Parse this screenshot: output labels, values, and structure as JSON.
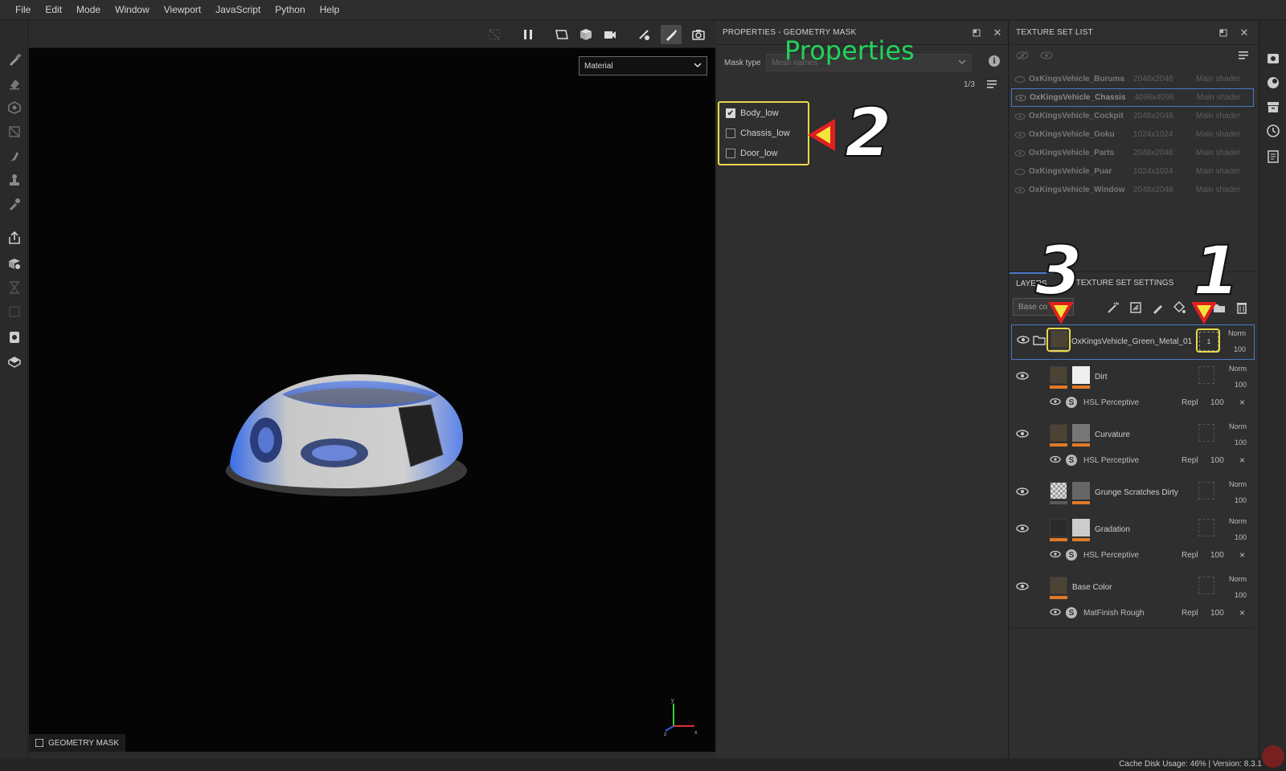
{
  "menu": [
    "File",
    "Edit",
    "Mode",
    "Window",
    "Viewport",
    "JavaScript",
    "Python",
    "Help"
  ],
  "viewport": {
    "material_select": "Material",
    "mode_label": "GEOMETRY MASK"
  },
  "properties": {
    "title": "PROPERTIES - GEOMETRY MASK",
    "mask_type_label": "Mask type",
    "mask_type_value": "Mesh names",
    "annotation": "Properties",
    "page_count": "1/3",
    "meshes": [
      {
        "name": "Body_low",
        "checked": true
      },
      {
        "name": "Chassis_low",
        "checked": false
      },
      {
        "name": "Door_low",
        "checked": false
      }
    ],
    "callout_number": "2"
  },
  "texture_set_list": {
    "title": "TEXTURE SET LIST",
    "items": [
      {
        "name": "OxKingsVehicle_Buruma",
        "resolution": "2048x2048",
        "shader": "Main shader"
      },
      {
        "name": "OxKingsVehicle_Chassis",
        "resolution": "4096x4096",
        "shader": "Main shader"
      },
      {
        "name": "OxKingsVehicle_Cockpit",
        "resolution": "2048x2048",
        "shader": "Main shader"
      },
      {
        "name": "OxKingsVehicle_Goku",
        "resolution": "1024x1024",
        "shader": "Main shader"
      },
      {
        "name": "OxKingsVehicle_Parts",
        "resolution": "2048x2048",
        "shader": "Main shader"
      },
      {
        "name": "OxKingsVehicle_Puar",
        "resolution": "1024x1024",
        "shader": "Main shader"
      },
      {
        "name": "OxKingsVehicle_Window",
        "resolution": "2048x2048",
        "shader": "Main shader"
      }
    ],
    "selected_index": 1
  },
  "layers": {
    "tab_layers": "LAYERS",
    "tab_settings": "TEXTURE SET SETTINGS",
    "channel": "Base co",
    "callout_1": "1",
    "callout_3": "3",
    "group": {
      "name": "OxKingsVehicle_Green_Metal_01",
      "blend": "Norm",
      "opacity": "100",
      "mask_badge": "1"
    },
    "items": [
      {
        "name": "Dirt",
        "blend": "Norm",
        "opacity": "100",
        "effect": {
          "name": "HSL Perceptive",
          "blend": "Repl",
          "opacity": "100"
        }
      },
      {
        "name": "Curvature",
        "blend": "Norm",
        "opacity": "100",
        "effect": {
          "name": "HSL Perceptive",
          "blend": "Repl",
          "opacity": "100"
        }
      },
      {
        "name": "Grunge Scratches Dirty",
        "blend": "Norm",
        "opacity": "100",
        "effect": null
      },
      {
        "name": "Gradation",
        "blend": "Norm",
        "opacity": "100",
        "effect": {
          "name": "HSL Perceptive",
          "blend": "Repl",
          "opacity": "100"
        }
      },
      {
        "name": "Base Color",
        "blend": "Norm",
        "opacity": "100",
        "effect": {
          "name": "MatFinish Rough",
          "blend": "Repl",
          "opacity": "100"
        }
      }
    ]
  },
  "status": {
    "text": "Cache Disk Usage:    46% | Version: 8.3.1"
  },
  "colors": {
    "accent_blue": "#4a78c8",
    "highlight_yellow": "#e8d84a",
    "annotation_green": "#22d35a",
    "arrow_red": "#e02020",
    "layer_orange": "#e07a28"
  }
}
